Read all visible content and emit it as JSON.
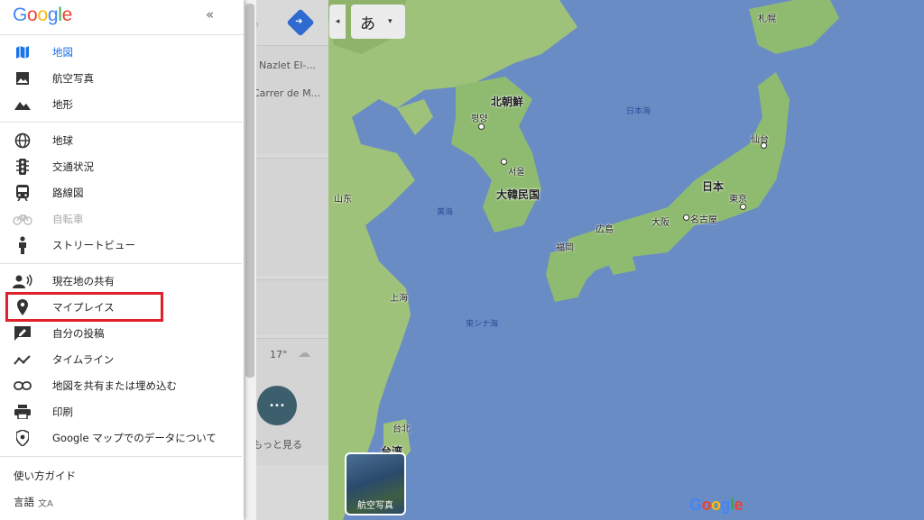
{
  "brand": {
    "logo_text": "Google",
    "colors": [
      "#4285f4",
      "#ea4335",
      "#fbbc05",
      "#4285f4",
      "#34a853",
      "#ea4335"
    ]
  },
  "menu": {
    "close_glyph": "«",
    "items_group1": [
      {
        "label": "地図",
        "icon": "map-icon",
        "active": true
      },
      {
        "label": "航空写真",
        "icon": "satellite-image-icon"
      },
      {
        "label": "地形",
        "icon": "terrain-icon"
      }
    ],
    "items_group2": [
      {
        "label": "地球",
        "icon": "globe-icon"
      },
      {
        "label": "交通状況",
        "icon": "traffic-light-icon"
      },
      {
        "label": "路線図",
        "icon": "train-icon"
      },
      {
        "label": "自転車",
        "icon": "bicycle-icon",
        "disabled": true
      },
      {
        "label": "ストリートビュー",
        "icon": "pegman-icon"
      }
    ],
    "items_group3": [
      {
        "label": "現在地の共有",
        "icon": "location-share-icon"
      },
      {
        "label": "マイプレイス",
        "icon": "place-pin-icon",
        "highlighted": true
      },
      {
        "label": "自分の投稿",
        "icon": "contributions-icon"
      },
      {
        "label": "タイムライン",
        "icon": "timeline-icon"
      },
      {
        "label": "地図を共有または埋め込む",
        "icon": "link-icon"
      },
      {
        "label": "印刷",
        "icon": "print-icon"
      },
      {
        "label": "Google マップでのデータについて",
        "icon": "shield-icon"
      }
    ],
    "footer": {
      "guide": "使い方ガイド",
      "language": "言語"
    }
  },
  "results_panel": {
    "row1": "Nazlet El-...",
    "row2": "Carrer de M...",
    "temperature": "17°",
    "more_label": "もっと見る",
    "more_glyph": "•••"
  },
  "top_controls": {
    "ime_char": "あ",
    "ime_caret": "▾",
    "collapse_glyph": "◂"
  },
  "satellite_toggle": {
    "label": "航空写真"
  },
  "map": {
    "labels": {
      "north_korea": "北朝鮮",
      "pyongyang": "평양",
      "seoul": "서울",
      "south_korea": "大韓民国",
      "japan": "日本",
      "tokyo": "東京",
      "nagoya": "名古屋",
      "osaka": "大阪",
      "hiroshima": "広島",
      "fukuoka": "福岡",
      "sendai": "仙台",
      "sapporo": "札幌",
      "sea_of_japan": "日本海",
      "yellow_sea": "黄海",
      "east_china_sea": "東シナ海",
      "shanghai": "上海",
      "taipei": "台北",
      "taiwan": "台湾",
      "shandong": "山东"
    },
    "logo": "Google"
  }
}
